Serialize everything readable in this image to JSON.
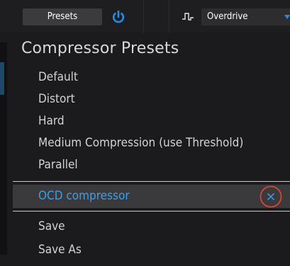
{
  "toolbar": {
    "presets_label": "Presets",
    "power_icon": "power-icon",
    "waveform_icon": "waveform-icon",
    "dropdown_value": "Overdrive",
    "accent_color": "#1e90e6"
  },
  "menu": {
    "title": "Compressor Presets",
    "items": [
      {
        "label": "Default"
      },
      {
        "label": "Distort"
      },
      {
        "label": "Hard"
      },
      {
        "label": "Medium Compression (use Threshold)"
      },
      {
        "label": "Parallel"
      }
    ],
    "selected": {
      "label": "OCD compressor",
      "label_color": "#3aa0e8",
      "delete_icon": "close-icon",
      "highlight_ring_color": "#e0432f"
    },
    "actions": [
      {
        "label": "Save"
      },
      {
        "label": "Save As"
      }
    ]
  }
}
